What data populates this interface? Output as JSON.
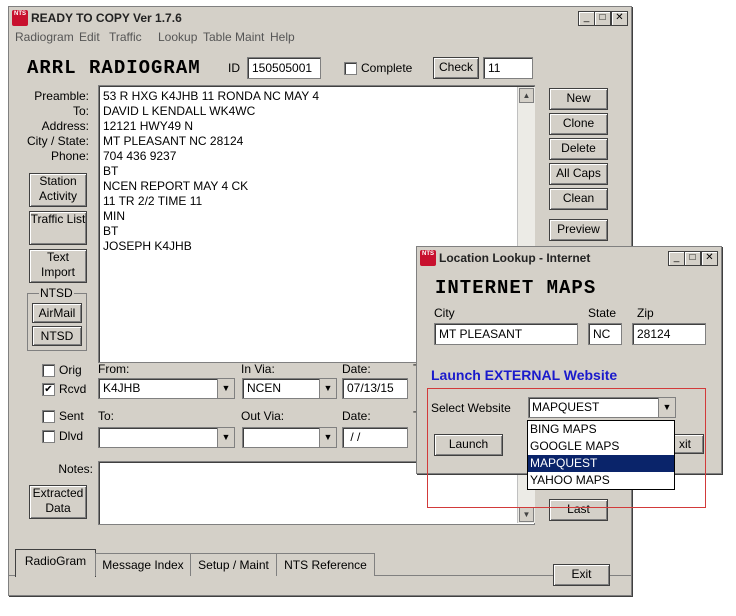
{
  "main_window": {
    "title": "READY TO COPY Ver 1.7.6",
    "logo": "NTS",
    "menu": [
      "Radiogram",
      "Edit",
      "Traffic",
      "Lookup",
      "Table Maint",
      "Help"
    ],
    "heading": "ARRL RADIOGRAM",
    "id_label": "ID",
    "id_value": "150505001",
    "complete_label": "Complete",
    "check_button": "Check",
    "check_value": "11",
    "row_labels": [
      "Preamble:",
      "To:",
      "Address:",
      "City / State:",
      "Phone:"
    ],
    "message_lines": [
      "53 R HXG K4JHB 11 RONDA NC MAY 4",
      "DAVID L KENDALL WK4WC",
      "12121 HWY49 N",
      "MT PLEASANT NC 28124",
      "704 436 9237",
      "BT",
      "NCEN REPORT MAY 4 CK",
      "11 TR 2/2 TIME 11",
      "MIN",
      "BT",
      "JOSEPH K4JHB"
    ],
    "side_buttons": {
      "station_activity": "Station Activity",
      "traffic_list": "Traffic List",
      "text_import": "Text Import",
      "ntsd_group": "NTSD",
      "airmail": "AirMail",
      "ntsd": "NTSD",
      "extracted_data": "Extracted Data"
    },
    "right_buttons": {
      "new": "New",
      "clone": "Clone",
      "delete": "Delete",
      "all_caps": "All Caps",
      "clean": "Clean",
      "preview": "Preview",
      "last": "Last",
      "exit": "Exit"
    },
    "orig_label": "Orig",
    "rcvd_label": "Rcvd",
    "sent_label": "Sent",
    "dlvd_label": "Dlvd",
    "from_label": "From:",
    "from_value": "K4JHB",
    "in_via_label": "In Via:",
    "in_via_value": "NCEN",
    "date_label": "Date:",
    "date_in_value": "07/13/15",
    "t_label": "T",
    "to_label": "To:",
    "to_value": "",
    "out_via_label": "Out Via:",
    "out_via_value": "",
    "date_out_label": "Date:",
    "date_out_value": " / /",
    "notes_label": "Notes:",
    "tabs": [
      "RadioGram",
      "Message Index",
      "Setup / Maint",
      "NTS Reference"
    ]
  },
  "lookup_window": {
    "title": "Location Lookup - Internet",
    "heading": "INTERNET MAPS",
    "city_label": "City",
    "city_value": "MT PLEASANT",
    "state_label": "State",
    "state_value": "NC",
    "zip_label": "Zip",
    "zip_value": "28124",
    "launch_heading": "Launch EXTERNAL Website",
    "select_label": "Select Website",
    "select_value": "MAPQUEST",
    "options": [
      "BING MAPS",
      "GOOGLE MAPS",
      "MAPQUEST",
      "YAHOO MAPS"
    ],
    "launch_button": "Launch",
    "exit_button_partial": "xit"
  },
  "colors": {
    "window_bg": "#d4d0c8",
    "selection": "#0a246a",
    "launch_heading": "#1a1acc",
    "highlight_box": "#d23a3a"
  }
}
